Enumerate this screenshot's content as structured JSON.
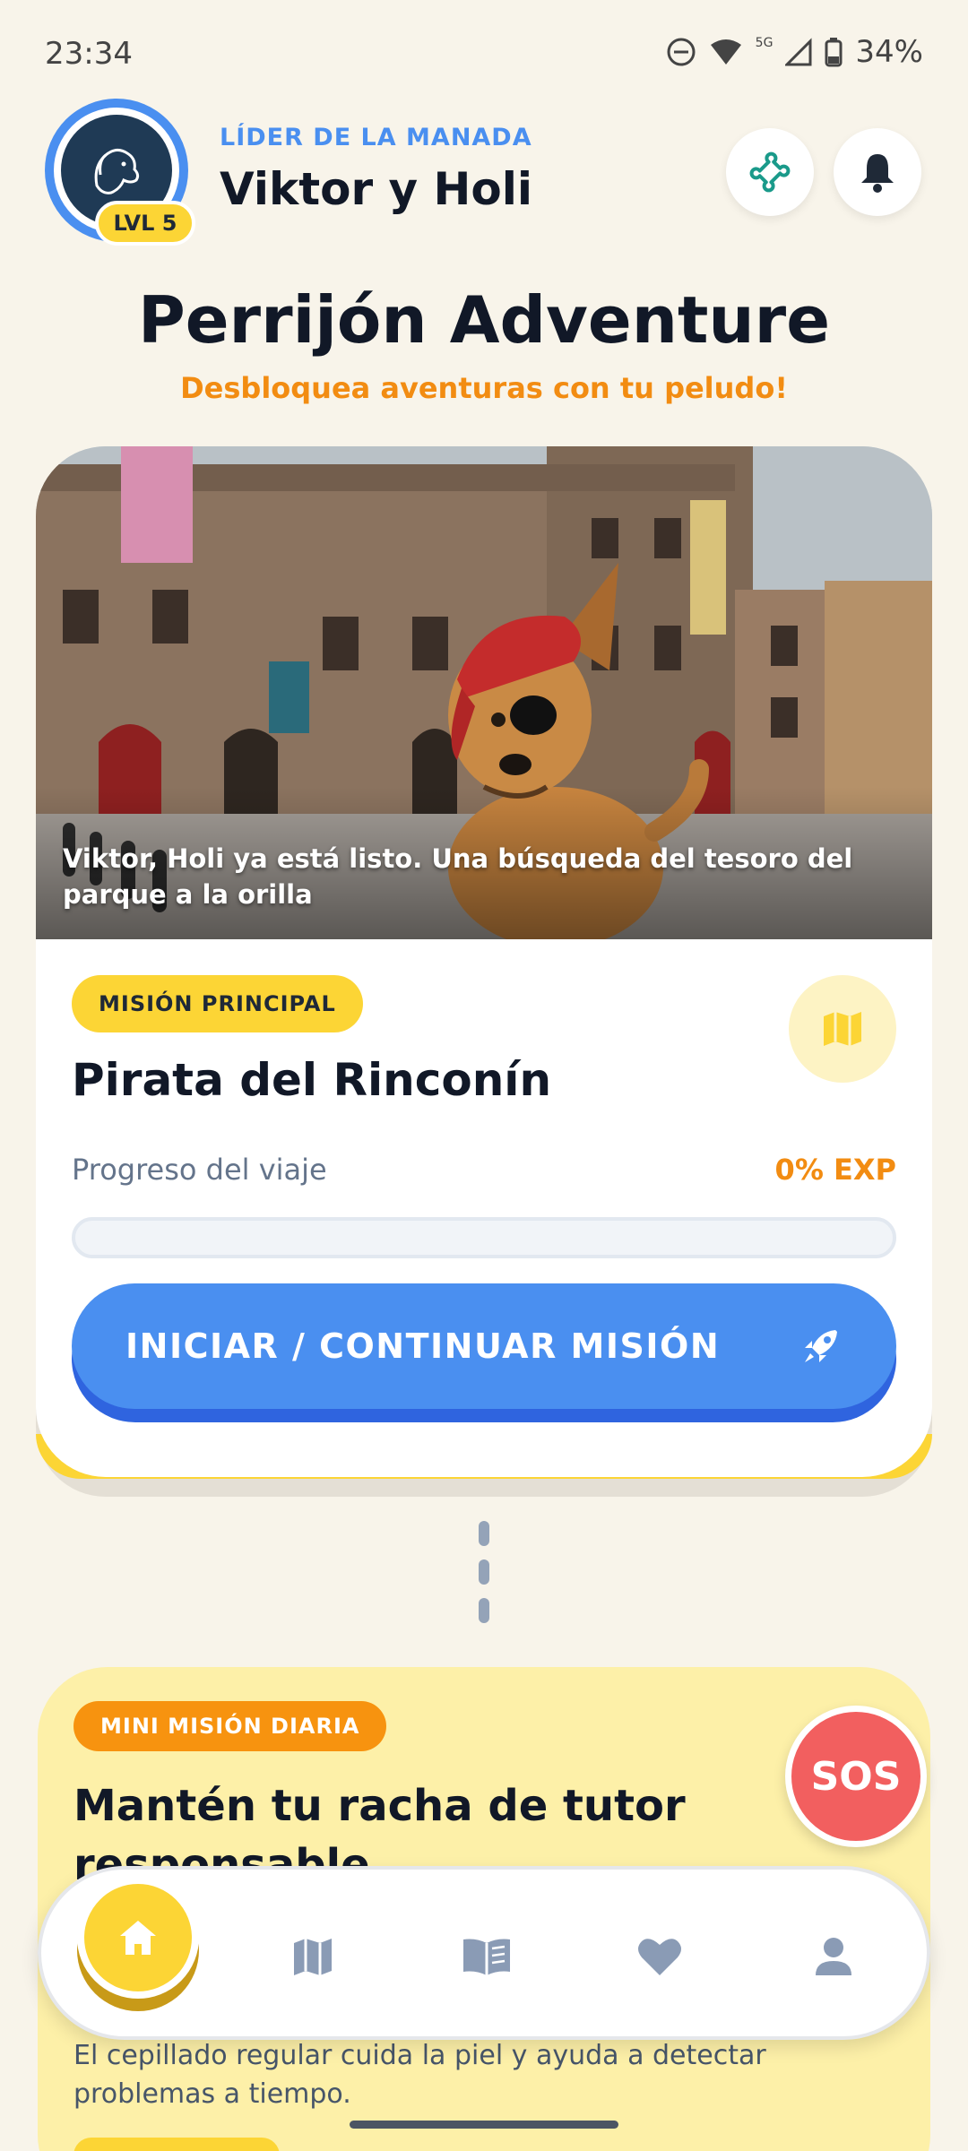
{
  "status_bar": {
    "time": "23:34",
    "battery": "34%",
    "network": "5G"
  },
  "header": {
    "role": "LÍDER DE LA MANADA",
    "name": "Viktor y Holi",
    "level": "LVL 5"
  },
  "app": {
    "title": "Perrijón Adventure",
    "subtitle": "Desbloquea aventuras con tu peludo!"
  },
  "main_mission": {
    "hero_caption": "Viktor, Holi ya está listo. Una búsqueda del tesoro del parque a la orilla",
    "badge": "MISIÓN PRINCIPAL",
    "title": "Pirata del Rinconín",
    "progress_label": "Progreso del viaje",
    "progress_value": "0% EXP",
    "progress_fraction": 0,
    "cta_label": "INICIAR / CONTINUAR MISIÓN"
  },
  "daily_mission": {
    "badge": "MINI MISIÓN DIARIA",
    "title": "Mantén tu racha de tutor responsable",
    "body": "El cepillado regular cuida la piel y ayuda a detectar problemas a tiempo."
  },
  "sos": {
    "label": "SOS"
  },
  "bottom_nav": {
    "items": [
      {
        "icon": "home-icon",
        "active": true
      },
      {
        "icon": "map-icon",
        "active": false
      },
      {
        "icon": "book-icon",
        "active": false
      },
      {
        "icon": "heart-icon",
        "active": false
      },
      {
        "icon": "person-icon",
        "active": false
      }
    ]
  },
  "colors": {
    "background": "#f8f4ea",
    "primary_blue": "#4a8ff0",
    "accent_yellow": "#fcd535",
    "accent_orange": "#f28c12",
    "sos_red": "#f25f5f",
    "daily_card": "#fdf0a8"
  }
}
